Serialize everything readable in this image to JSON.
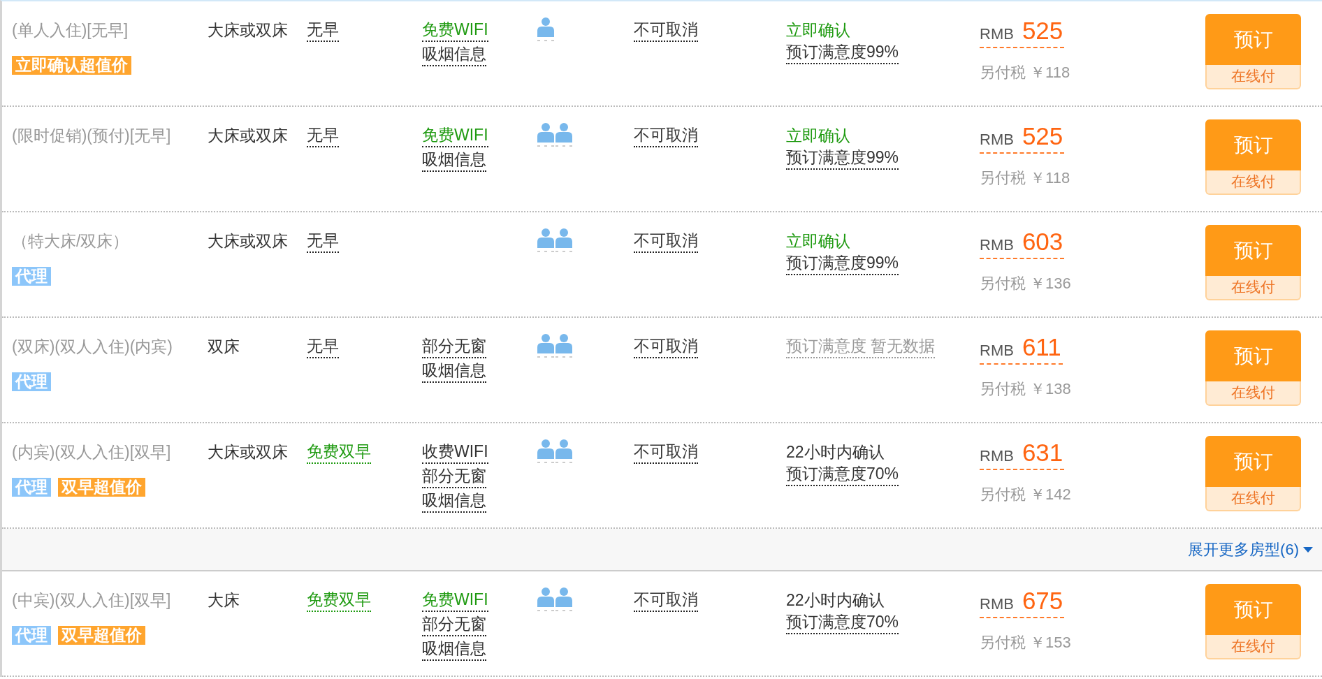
{
  "rows": [
    {
      "kind": "room",
      "name": "(单人入住)[无早]",
      "tags": [
        {
          "label": "立即确认超值价",
          "color": "#ffa52e"
        }
      ],
      "bed": "大床或双床",
      "breakfast": {
        "text": "无早",
        "included": false
      },
      "facilities": [
        {
          "text": "免费WIFI",
          "highlighted": true
        },
        {
          "text": "吸烟信息",
          "highlighted": false
        }
      ],
      "occupancy": {
        "kind": "single"
      },
      "cancellation": "不可取消",
      "confirmation": [
        {
          "text": "立即确认",
          "kind": "instant"
        },
        {
          "text": "预订满意度99%",
          "kind": "rating"
        }
      ],
      "price": {
        "currency": "RMB",
        "amount": "525",
        "tax": "另付税 ￥118"
      },
      "book_button": {
        "label": "预订",
        "sublabel": "在线付"
      }
    },
    {
      "kind": "room",
      "name": "(限时促销)(预付)[无早]",
      "tags": [],
      "bed": "大床或双床",
      "breakfast": {
        "text": "无早",
        "included": false
      },
      "facilities": [
        {
          "text": "免费WIFI",
          "highlighted": true
        },
        {
          "text": "吸烟信息",
          "highlighted": false
        }
      ],
      "occupancy": {
        "kind": "double"
      },
      "cancellation": "不可取消",
      "confirmation": [
        {
          "text": "立即确认",
          "kind": "instant"
        },
        {
          "text": "预订满意度99%",
          "kind": "rating"
        }
      ],
      "price": {
        "currency": "RMB",
        "amount": "525",
        "tax": "另付税 ￥118"
      },
      "book_button": {
        "label": "预订",
        "sublabel": "在线付"
      }
    },
    {
      "kind": "room",
      "name": "（特大床/双床）",
      "tags": [
        {
          "label": "代理",
          "color": "#8cc6fa"
        }
      ],
      "bed": "大床或双床",
      "breakfast": {
        "text": "无早",
        "included": false
      },
      "facilities": [],
      "occupancy": {
        "kind": "double"
      },
      "cancellation": "不可取消",
      "confirmation": [
        {
          "text": "立即确认",
          "kind": "instant"
        },
        {
          "text": "预订满意度99%",
          "kind": "rating"
        }
      ],
      "price": {
        "currency": "RMB",
        "amount": "603",
        "tax": "另付税 ￥136"
      },
      "book_button": {
        "label": "预订",
        "sublabel": "在线付"
      }
    },
    {
      "kind": "room",
      "name": "(双床)(双人入住)(内宾)",
      "tags": [
        {
          "label": "代理",
          "color": "#8cc6fa"
        }
      ],
      "bed": "双床",
      "breakfast": {
        "text": "无早",
        "included": false
      },
      "facilities": [
        {
          "text": "部分无窗",
          "highlighted": false
        },
        {
          "text": "吸烟信息",
          "highlighted": false
        }
      ],
      "occupancy": {
        "kind": "double"
      },
      "cancellation": "不可取消",
      "confirmation": [
        {
          "text": "预订满意度 暂无数据",
          "kind": "no_rating"
        }
      ],
      "price": {
        "currency": "RMB",
        "amount": "611",
        "tax": "另付税 ￥138"
      },
      "book_button": {
        "label": "预订",
        "sublabel": "在线付"
      }
    },
    {
      "kind": "room",
      "name": "(内宾)(双人入住)[双早]",
      "tags": [
        {
          "label": "代理",
          "color": "#8cc6fa"
        },
        {
          "label": "双早超值价",
          "color": "#ffa52e"
        }
      ],
      "bed": "大床或双床",
      "breakfast": {
        "text": "免费双早",
        "included": true
      },
      "facilities": [
        {
          "text": "收费WIFI",
          "highlighted": false
        },
        {
          "text": "部分无窗",
          "highlighted": false
        },
        {
          "text": "吸烟信息",
          "highlighted": false
        }
      ],
      "occupancy": {
        "kind": "double"
      },
      "cancellation": "不可取消",
      "confirmation": [
        {
          "text": "22小时内确认",
          "kind": "timed"
        },
        {
          "text": "预订满意度70%",
          "kind": "rating"
        }
      ],
      "price": {
        "currency": "RMB",
        "amount": "631",
        "tax": "另付税 ￥142"
      },
      "book_button": {
        "label": "预订",
        "sublabel": "在线付"
      }
    },
    {
      "kind": "expand",
      "label": "展开更多房型(6)"
    },
    {
      "kind": "room",
      "name": "(中宾)(双人入住)[双早]",
      "tags": [
        {
          "label": "代理",
          "color": "#8cc6fa"
        },
        {
          "label": "双早超值价",
          "color": "#ffa52e"
        }
      ],
      "bed": "大床",
      "breakfast": {
        "text": "免费双早",
        "included": true
      },
      "facilities": [
        {
          "text": "免费WIFI",
          "highlighted": true
        },
        {
          "text": "部分无窗",
          "highlighted": false
        },
        {
          "text": "吸烟信息",
          "highlighted": false
        }
      ],
      "occupancy": {
        "kind": "double"
      },
      "cancellation": "不可取消",
      "confirmation": [
        {
          "text": "22小时内确认",
          "kind": "timed"
        },
        {
          "text": "预订满意度70%",
          "kind": "rating"
        }
      ],
      "price": {
        "currency": "RMB",
        "amount": "675",
        "tax": "另付税 ￥153"
      },
      "book_button": {
        "label": "预订",
        "sublabel": "在线付"
      }
    }
  ]
}
